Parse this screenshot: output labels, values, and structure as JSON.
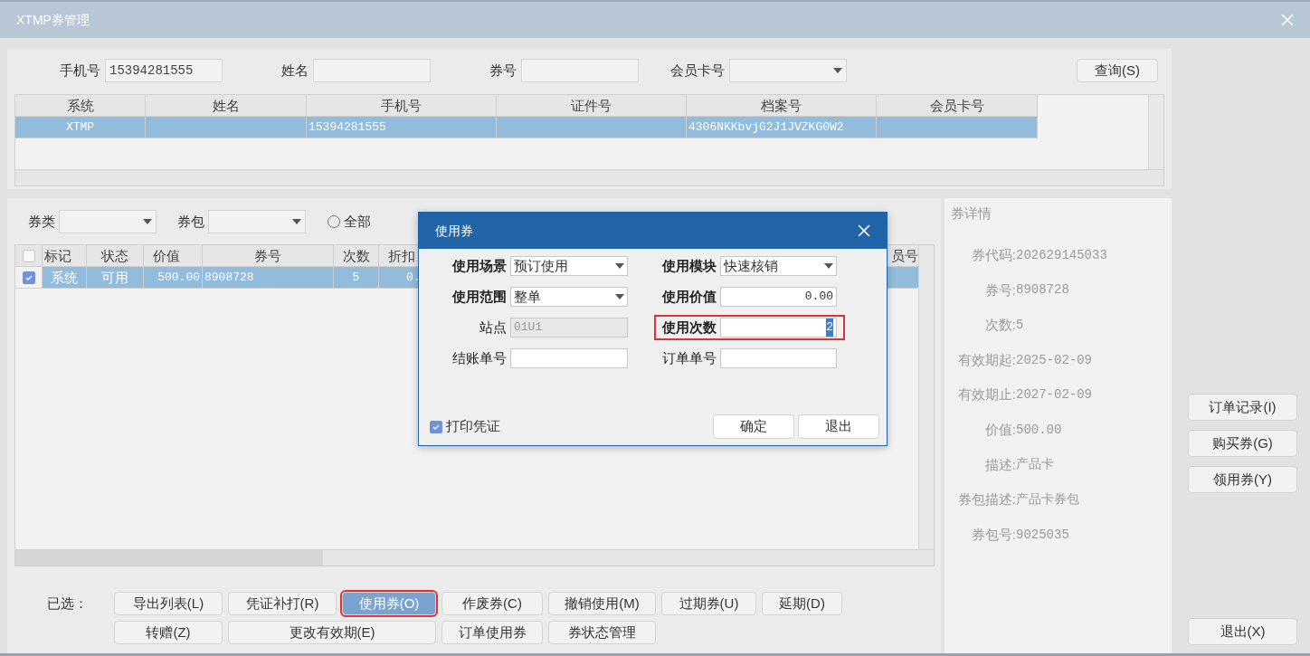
{
  "window": {
    "title": "XTMP券管理"
  },
  "search": {
    "fields": [
      {
        "label": "手机号",
        "kind": "text",
        "value": "15394281555"
      },
      {
        "label": "姓名",
        "kind": "text"
      },
      {
        "label": "券号",
        "kind": "text"
      },
      {
        "label": "会员卡号",
        "kind": "dropdown"
      }
    ],
    "button": "查询(S)"
  },
  "customer_table": {
    "columns": [
      "系统",
      "姓名",
      "手机号",
      "证件号",
      "档案号",
      "会员卡号"
    ],
    "rows": [
      {
        "selected": true,
        "cells": [
          "XTMP",
          null,
          "15394281555",
          null,
          "4306NKKbvjG2J1JVZKG0W2",
          null
        ]
      }
    ]
  },
  "filters": [
    {
      "kind": "dropdown",
      "label": "券类"
    },
    {
      "kind": "dropdown",
      "label": "券包"
    },
    {
      "kind": "radio",
      "label": "全部",
      "selected": false
    }
  ],
  "coupon_table": {
    "header_checked": false,
    "columns": [
      "标记",
      "状态",
      "价值",
      "券号",
      "次数",
      "折扣",
      "员号"
    ],
    "rows": [
      {
        "selected": true,
        "checked": true,
        "cells": [
          "系统",
          "可用",
          "500.00",
          "8908728",
          "5",
          "0.",
          null
        ]
      }
    ]
  },
  "actions": {
    "label": "已选：",
    "rows": [
      [
        {
          "label": "导出列表(L)",
          "selected": false,
          "highlighted": false
        },
        {
          "label": "凭证补打(R)",
          "selected": false,
          "highlighted": false
        },
        {
          "label": "使用券(O)",
          "selected": true,
          "highlighted": true
        },
        {
          "label": "作废券(C)",
          "selected": false,
          "highlighted": false
        },
        {
          "label": "撤销使用(M)",
          "selected": false,
          "highlighted": false
        },
        {
          "label": "过期券(U)",
          "selected": false,
          "highlighted": false
        },
        {
          "label": "延期(D)",
          "selected": false,
          "highlighted": false
        }
      ],
      [
        {
          "label": "转赠(Z)",
          "selected": false,
          "highlighted": false
        },
        {
          "label": "更改有效期(E)",
          "selected": false,
          "highlighted": false,
          "colspan": 2
        },
        {
          "label": "订单使用券",
          "selected": false,
          "highlighted": false
        },
        {
          "label": "券状态管理",
          "selected": false,
          "highlighted": false
        }
      ]
    ]
  },
  "details": {
    "title": "券详情",
    "lines": [
      {
        "label": "券代码:",
        "value": "202629145033"
      },
      {
        "label": "券号:",
        "value": "8908728"
      },
      {
        "label": "次数:",
        "value": "5"
      },
      {
        "label": "有效期起:",
        "value": "2025-02-09"
      },
      {
        "label": "有效期止:",
        "value": "2027-02-09"
      },
      {
        "label": "价值:",
        "value": "500.00"
      },
      {
        "label": "描述:",
        "value": "产品卡"
      },
      {
        "label": "券包描述:",
        "value": "产品卡券包"
      },
      {
        "label": "券包号:",
        "value": "9025035"
      }
    ]
  },
  "side_buttons": [
    "订单记录(I)",
    "购买券(G)",
    "领用券(Y)"
  ],
  "exit_button": "退出(X)",
  "dialog": {
    "title": "使用券",
    "fields": [
      {
        "label": "使用场景",
        "bold": true,
        "kind": "dropdown",
        "value": "预订使用",
        "disabled": false,
        "highlighted": false
      },
      {
        "label": "使用模块",
        "bold": true,
        "kind": "dropdown",
        "value": "快速核销",
        "disabled": false,
        "highlighted": false
      },
      {
        "label": "使用范围",
        "bold": true,
        "kind": "dropdown",
        "value": "整单",
        "disabled": false,
        "highlighted": false
      },
      {
        "label": "使用价值",
        "bold": true,
        "kind": "number",
        "value": "0.00",
        "disabled": false,
        "highlighted": false
      },
      {
        "label": "站点",
        "bold": false,
        "kind": "text",
        "value": "01U1",
        "disabled": true,
        "highlighted": false
      },
      {
        "label": "使用次数",
        "bold": true,
        "kind": "number",
        "value": "2",
        "text_selected": true,
        "disabled": false,
        "highlighted": true
      },
      {
        "label": "结账单号",
        "bold": false,
        "kind": "text",
        "disabled": false,
        "highlighted": false
      },
      {
        "label": "订单单号",
        "bold": false,
        "kind": "text",
        "disabled": false,
        "highlighted": false
      }
    ],
    "print_checkbox": {
      "label": "打印凭证",
      "checked": true
    },
    "buttons": [
      "确定",
      "退出"
    ]
  }
}
